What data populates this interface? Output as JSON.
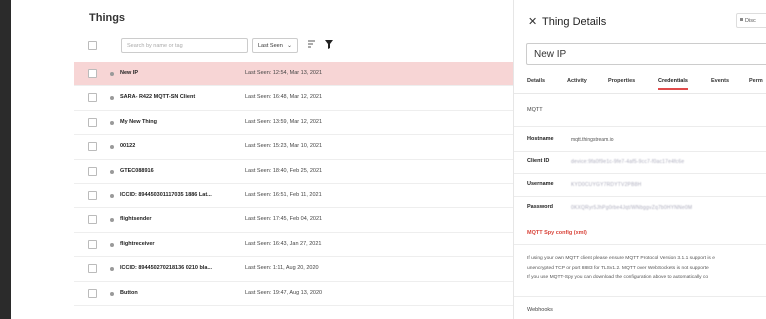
{
  "things": {
    "title": "Things",
    "search_placeholder": "Search by name or tag",
    "sort_select": "Last Seen",
    "rows": [
      {
        "name": "New IP",
        "last_seen": "Last Seen: 12:54, Mar 13, 2021",
        "selected": true
      },
      {
        "name": "SARA- R422 MQTT-SN Client",
        "last_seen": "Last Seen: 16:48, Mar 12, 2021"
      },
      {
        "name": "My New Thing",
        "last_seen": "Last Seen: 13:59, Mar 12, 2021"
      },
      {
        "name": "00122",
        "last_seen": "Last Seen: 15:23, Mar 10, 2021"
      },
      {
        "name": "GTEC088916",
        "last_seen": "Last Seen: 18:40, Feb 25, 2021"
      },
      {
        "name": "ICCID: 894450301117035 1886 Lat...",
        "last_seen": "Last Seen: 16:51, Feb 11, 2021"
      },
      {
        "name": "flightsender",
        "last_seen": "Last Seen: 17:45, Feb 04, 2021"
      },
      {
        "name": "flightreceiver",
        "last_seen": "Last Seen: 16:43, Jan 27, 2021"
      },
      {
        "name": "ICCID: 894450270218136 0210 bla...",
        "last_seen": "Last Seen: 1:11, Aug 20, 2020"
      },
      {
        "name": "Button",
        "last_seen": "Last Seen: 19:47, Aug 13, 2020"
      }
    ]
  },
  "details": {
    "title": "Thing Details",
    "disconnect_label": "Disc",
    "name_value": "New IP",
    "tabs": [
      "Details",
      "Activity",
      "Properties",
      "Credentials",
      "Events",
      "Perm"
    ],
    "active_tab": "Credentials",
    "section": "MQTT",
    "fields": [
      {
        "label": "Hostname",
        "value": "mqtt.thingstream.io"
      },
      {
        "label": "Client ID",
        "value": "device:9fa0f9e1c-9fe7-4af5-9cc7-f0ac17e4fc6e"
      },
      {
        "label": "Username",
        "value": "KYD0CUYGY7RDYTV2PB8H"
      },
      {
        "label": "Password",
        "value": "0KXQRyr5JhPg0rbe4Jqt/WNbggvZq7b0HYNNe0M"
      }
    ],
    "spy_link": "MQTT Spy config (xml)",
    "paragraph": [
      "If using your own MQTT client please ensure MQTT Protocol Version 3.1.1 support is e",
      "unencrypted TCP or port 8883 for TLSv1.2. MQTT over WebSockets is not supporte",
      "If you use MQTT-Spy you can download the configuration above to automatically co"
    ],
    "webhooks_label": "Webhooks"
  }
}
